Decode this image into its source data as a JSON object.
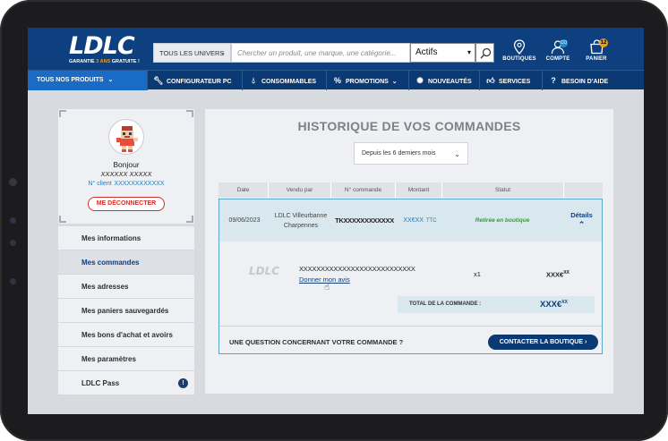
{
  "header": {
    "logo_text": "LDLC",
    "logo_tagline_pre": "GARANTIE ",
    "logo_tagline_years": "3 ANS",
    "logo_tagline_post": " GRATUITE !",
    "univers_label": "TOUS LES UNIVERS",
    "search_placeholder": "Chercher un produit, une marque, une catégorie...",
    "filter_value": "Actifs",
    "boutiques_label": "BOUTIQUES",
    "compte_label": "COMPTE",
    "compte_badge": "CO",
    "panier_label": "PANIER",
    "panier_count": "12"
  },
  "nav": {
    "items": [
      {
        "label": "TOUS NOS PRODUITS",
        "icon": "chevron-down-icon"
      },
      {
        "label": "CONFIGURATEUR PC",
        "icon": "wrench-icon"
      },
      {
        "label": "CONSOMMABLES",
        "icon": "drop-icon"
      },
      {
        "label": "PROMOTIONS",
        "icon": "percent-icon"
      },
      {
        "label": "NOUVEAUTÉS",
        "icon": "sparkle-icon"
      },
      {
        "label": "SERVICES",
        "icon": "thumbs-up-icon"
      },
      {
        "label": "BESOIN D'AIDE",
        "icon": "question-icon"
      }
    ]
  },
  "profile": {
    "greeting": "Bonjour",
    "name": "XXXXXX XXXXX",
    "client_label": "N° client",
    "client_number": "XXXXXXXXXXXX",
    "logout_label": "ME DÉCONNECTER"
  },
  "menu": {
    "items": [
      {
        "label": "Mes informations"
      },
      {
        "label": "Mes commandes"
      },
      {
        "label": "Mes adresses"
      },
      {
        "label": "Mes paniers sauvegardés"
      },
      {
        "label": "Mes bons d'achat et avoirs"
      },
      {
        "label": "Mes paramètres"
      },
      {
        "label": "LDLC Pass"
      }
    ],
    "active_index": 1
  },
  "orders": {
    "title": "HISTORIQUE DE VOS COMMANDES",
    "period": "Depuis les 6 derniers mois",
    "columns": [
      "Date",
      "Vendu par",
      "N° commande",
      "Montant",
      "Statut"
    ],
    "order": {
      "date": "09/06/2023",
      "seller_line1": "LDLC Villeurbanne",
      "seller_line2": "Charpennes",
      "number": "TKXXXXXXXXXXXX",
      "amount": "XX€XX",
      "amount_suffix": "TTC",
      "status": "Retirée en boutique",
      "details_label": "Détails"
    },
    "item": {
      "brand": "LDLC",
      "name": "XXXXXXXXXXXXXXXXXXXXXXXXXXX",
      "review_link": "Donner mon avis",
      "qty": "x1",
      "price": "XXX€",
      "price_cents": "XX"
    },
    "total_label": "TOTAL DE LA COMMANDE :",
    "total_value": "XXX€",
    "total_cents": "XX",
    "question": "UNE QUESTION CONCERNANT VOTRE COMMANDE ?",
    "contact_label": "CONTACTER LA BOUTIQUE ›"
  }
}
